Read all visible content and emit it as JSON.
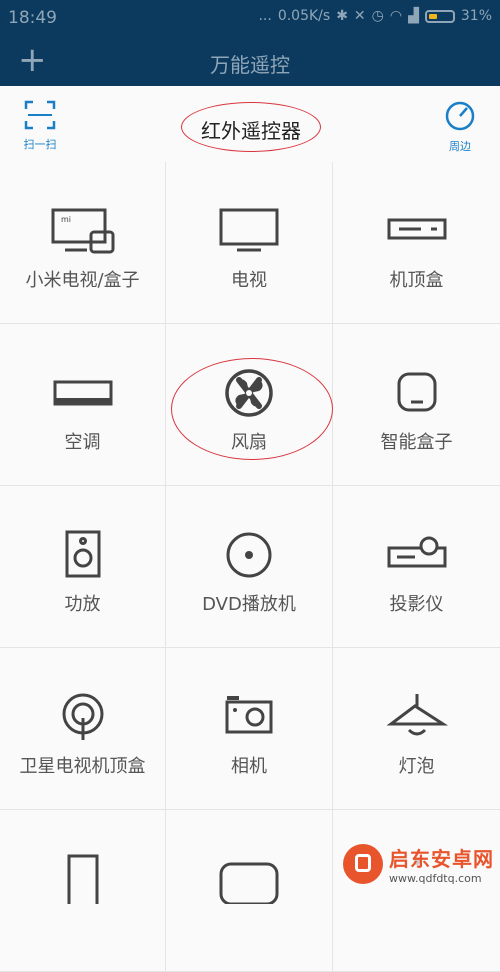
{
  "status": {
    "time": "18:49",
    "dots": "...",
    "speed": "0.05K/s",
    "battery": "31%"
  },
  "topbar": {
    "add_label": "+",
    "title": "万能遥控"
  },
  "header": {
    "scan_label": "扫一扫",
    "title": "红外遥控器",
    "nearby_label": "周边"
  },
  "devices": [
    {
      "label": "小米电视/盒子",
      "icon": "mi-tv-box-icon"
    },
    {
      "label": "电视",
      "icon": "tv-icon"
    },
    {
      "label": "机顶盒",
      "icon": "set-top-box-icon"
    },
    {
      "label": "空调",
      "icon": "air-conditioner-icon"
    },
    {
      "label": "风扇",
      "icon": "fan-icon"
    },
    {
      "label": "智能盒子",
      "icon": "smart-box-icon"
    },
    {
      "label": "功放",
      "icon": "speaker-icon"
    },
    {
      "label": "DVD播放机",
      "icon": "dvd-icon"
    },
    {
      "label": "投影仪",
      "icon": "projector-icon"
    },
    {
      "label": "卫星电视机顶盒",
      "icon": "satellite-box-icon"
    },
    {
      "label": "相机",
      "icon": "camera-icon"
    },
    {
      "label": "灯泡",
      "icon": "lamp-icon"
    },
    {
      "label": "",
      "icon": "tablet-icon"
    },
    {
      "label": "",
      "icon": "round-rect-icon"
    },
    {
      "label": "",
      "icon": "misc-icon"
    }
  ],
  "watermark": {
    "brand": "启东安卓网",
    "url": "www.qdfdtq.com"
  },
  "colors": {
    "bar_bg": "#0c3a5e",
    "accent_blue": "#1a7fc7",
    "annotation_red": "#d9363e"
  }
}
